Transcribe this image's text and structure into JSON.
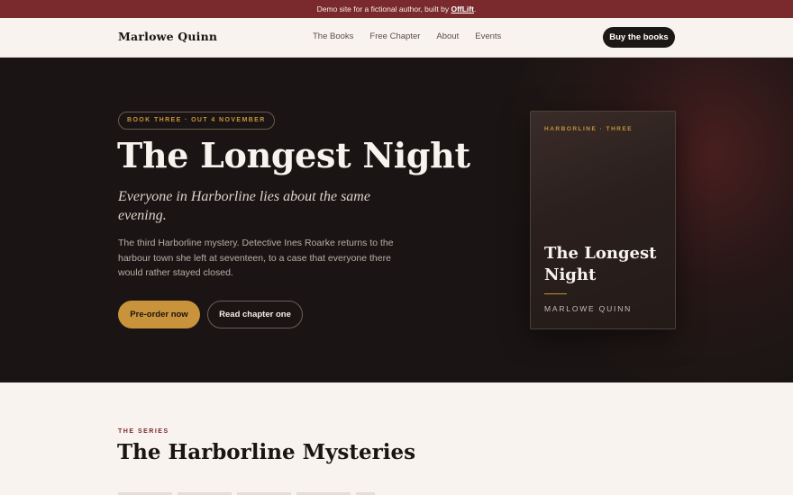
{
  "announcement": {
    "text_before": "Demo site for a fictional author, built by ",
    "link": "OffLift",
    "text_after": "."
  },
  "nav": {
    "brand": "Marlowe Quinn",
    "links": [
      "The Books",
      "Free Chapter",
      "About",
      "Events"
    ],
    "cta": "Buy the books"
  },
  "hero": {
    "badge": "BOOK THREE · OUT 4 NOVEMBER",
    "title": "The Longest Night",
    "tagline": "Everyone in Harborline lies about the same evening.",
    "description": "The third Harborline mystery. Detective Ines Roarke returns to the harbour town she left at seventeen, to a case that everyone there would rather stayed closed.",
    "primary_button": "Pre-order now",
    "secondary_button": "Read chapter one"
  },
  "cover": {
    "series": "HARBORLINE · THREE",
    "title": "The Longest Night",
    "author": "MARLOWE QUINN"
  },
  "series_section": {
    "eyebrow": "THE SERIES",
    "title": "The Harborline Mysteries"
  },
  "colors": {
    "announcement_bg": "#7a2a2c",
    "hero_bg": "#1a1514",
    "accent_gold": "#c8933a",
    "page_bg": "#f8f3ee"
  }
}
